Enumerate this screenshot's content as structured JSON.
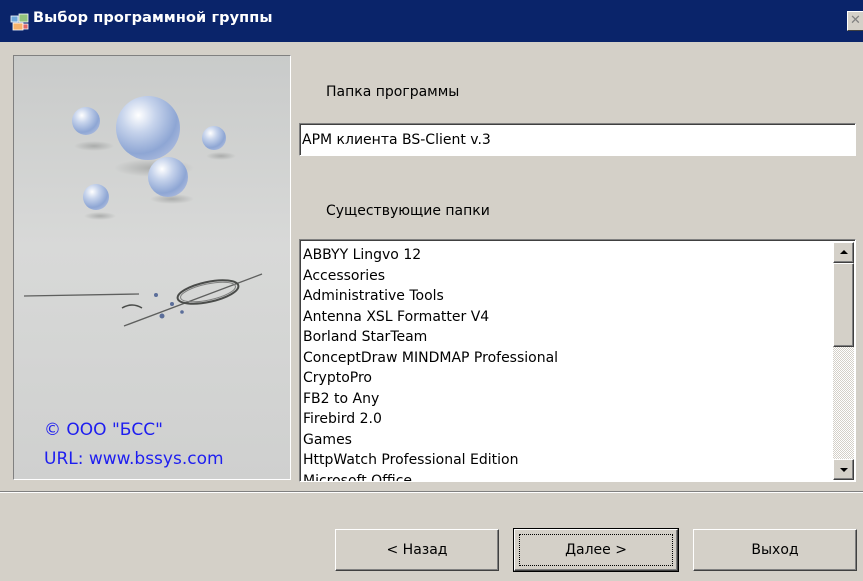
{
  "window": {
    "title": "Выбор программной группы",
    "close_symbol": "✕"
  },
  "left_panel": {
    "copyright": "© ООО \"БСС\"",
    "url": "URL: www.bssys.com"
  },
  "folder": {
    "label": "Папка программы",
    "value": "АРМ клиента BS-Client v.3"
  },
  "existing": {
    "label": "Существующие папки",
    "items": [
      "ABBYY Lingvo 12",
      "Accessories",
      "Administrative Tools",
      "Antenna XSL Formatter V4",
      "Borland StarTeam",
      "ConceptDraw MINDMAP Professional",
      "CryptoPro",
      "FB2 to Any",
      "Firebird 2.0",
      "Games",
      "HttpWatch Professional Edition",
      "Microsoft Office"
    ]
  },
  "buttons": {
    "back": "< Назад",
    "next": "Далее >",
    "exit": "Выход"
  },
  "colors": {
    "titlebar": "#0a246a",
    "face": "#d4d0c8",
    "link_text": "#1e1ef0"
  },
  "icons": {
    "title": "program-group-icon",
    "close": "close-icon",
    "scroll_up": "arrow-up-icon",
    "scroll_down": "arrow-down-icon"
  }
}
